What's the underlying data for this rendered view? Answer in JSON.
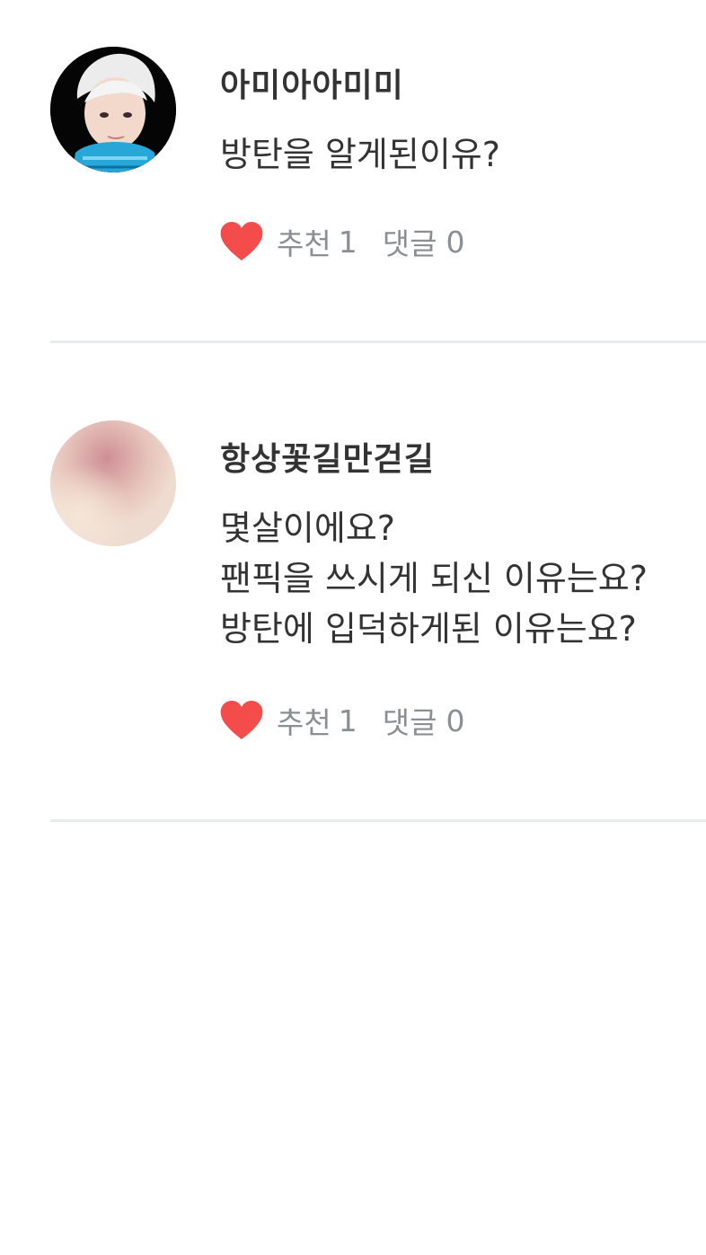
{
  "comments": [
    {
      "username": "아미아아미미",
      "lines": [
        "방탄을 알게된이유?"
      ],
      "like_label": "추천",
      "like_count": "1",
      "reply_label": "댓글",
      "reply_count": "0"
    },
    {
      "username": "항상꽃길만걷길",
      "lines": [
        "몇살이에요?",
        "팬픽을 쓰시게 되신 이유는요?",
        "방탄에 입덕하게된 이유는요?"
      ],
      "like_label": "추천",
      "like_count": "1",
      "reply_label": "댓글",
      "reply_count": "0"
    }
  ],
  "icons": {
    "like": "heart-icon"
  },
  "colors": {
    "heart": "#f44b4b",
    "meta_text": "#8a8f94",
    "divider": "#e8ecee"
  }
}
